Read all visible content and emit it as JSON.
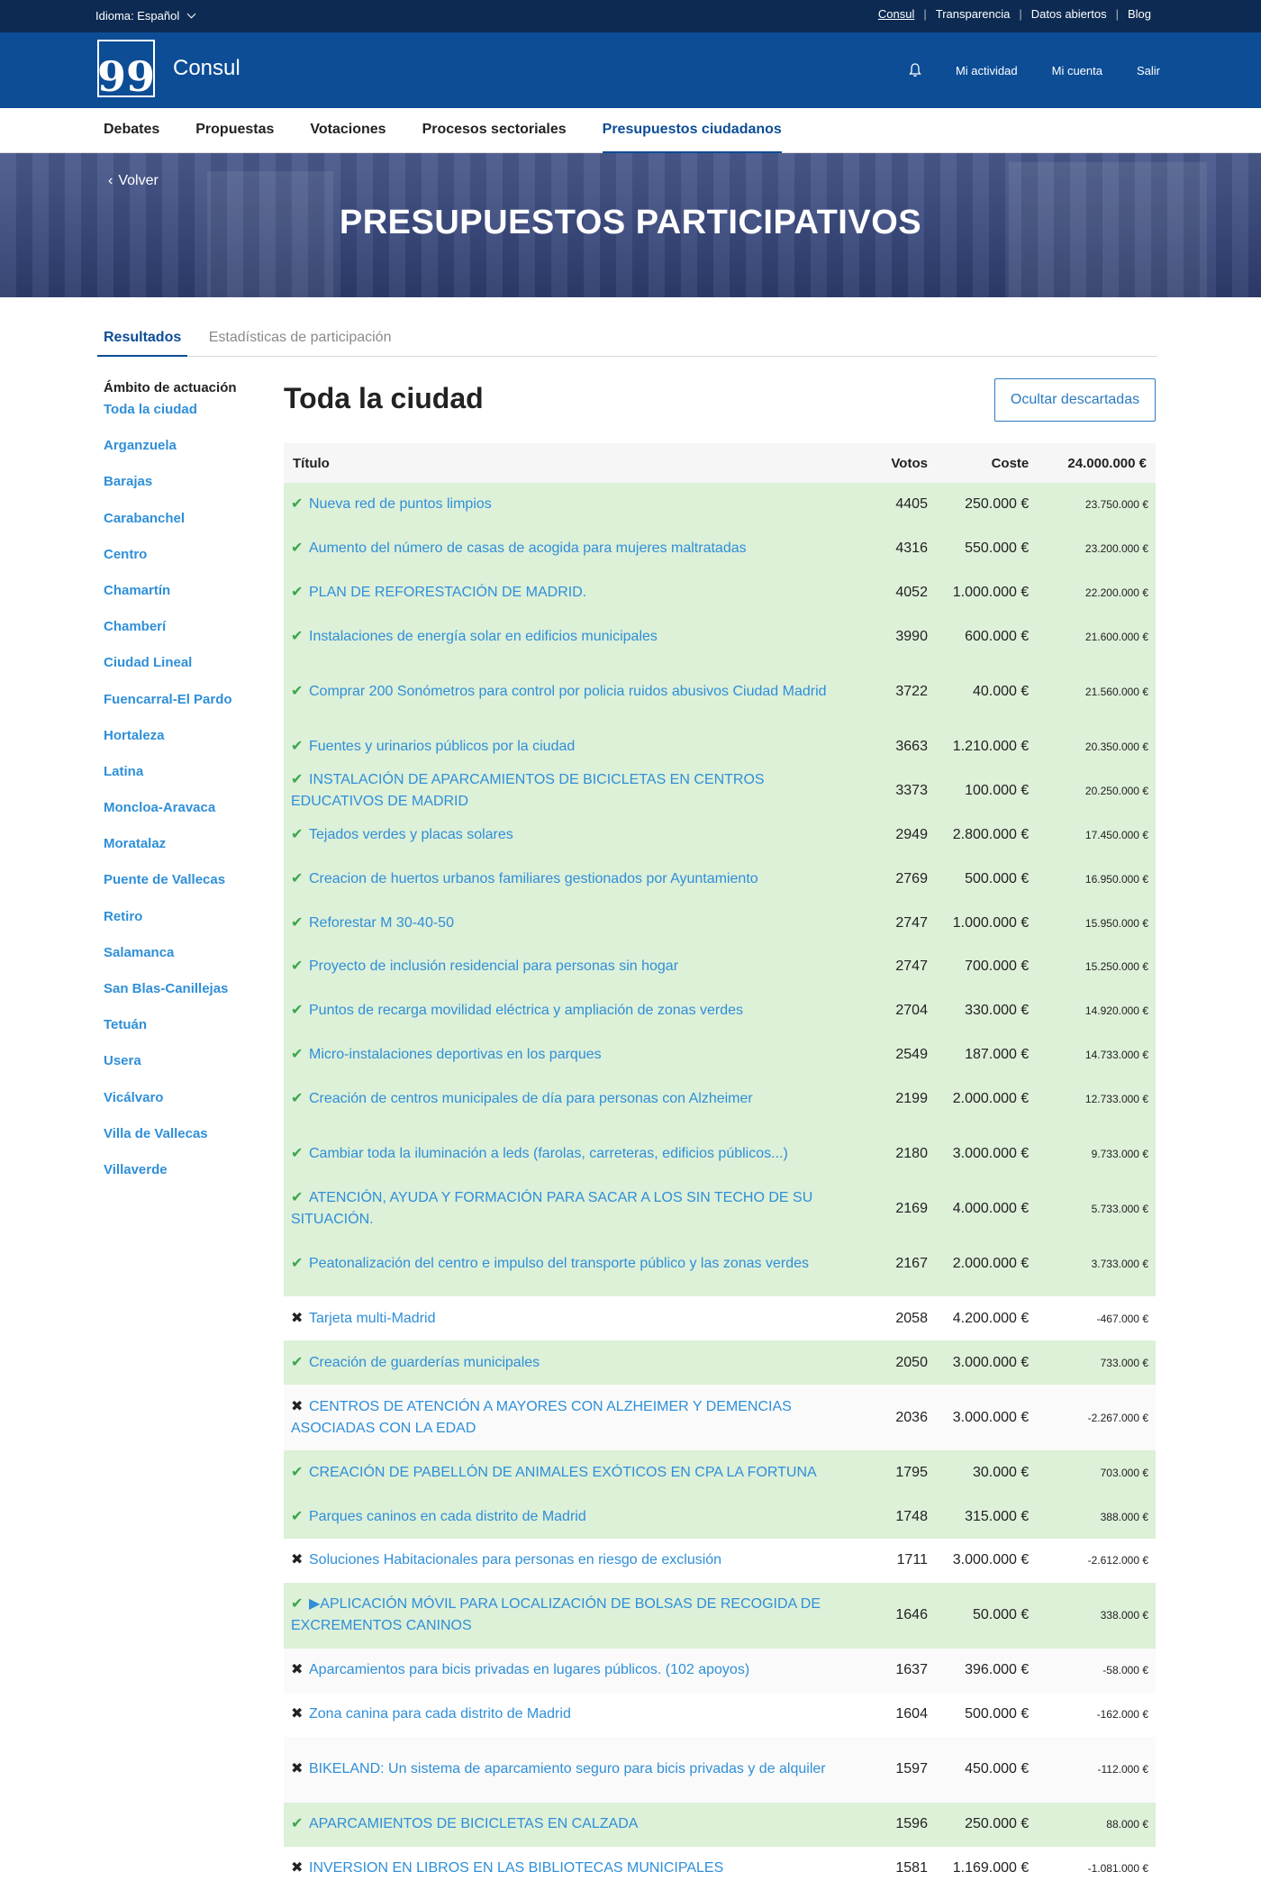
{
  "topbar": {
    "language_label": "Idioma:",
    "language_value": "Español",
    "links": [
      "Consul",
      "Transparencia",
      "Datos abiertos",
      "Blog"
    ]
  },
  "header": {
    "logo_glyph": "99",
    "app_name": "Consul",
    "user_nav": [
      "Mi actividad",
      "Mi cuenta",
      "Salir"
    ]
  },
  "main_nav": [
    "Debates",
    "Propuestas",
    "Votaciones",
    "Procesos sectoriales",
    "Presupuestos ciudadanos"
  ],
  "hero": {
    "back_label": "Volver",
    "title": "PRESUPUESTOS PARTICIPATIVOS"
  },
  "tabs": [
    "Resultados",
    "Estadísticas de participación"
  ],
  "sidebar": {
    "title": "Ámbito de actuación",
    "items": [
      "Toda la ciudad",
      "Arganzuela",
      "Barajas",
      "Carabanchel",
      "Centro",
      "Chamartín",
      "Chamberí",
      "Ciudad Lineal",
      "Fuencarral-El Pardo",
      "Hortaleza",
      "Latina",
      "Moncloa-Aravaca",
      "Moratalaz",
      "Puente de Vallecas",
      "Retiro",
      "Salamanca",
      "San Blas-Canillejas",
      "Tetuán",
      "Usera",
      "Vicálvaro",
      "Villa de Vallecas",
      "Villaverde"
    ]
  },
  "content": {
    "heading": "Toda la ciudad",
    "hide_button": "Ocultar descartadas",
    "table_headers": {
      "title": "Título",
      "votes": "Votos",
      "cost": "Coste",
      "total": "24.000.000 €"
    },
    "rows": [
      {
        "selected": true,
        "title": "Nueva red de puntos limpios",
        "votes": "4405",
        "cost": "250.000 €",
        "remaining": "23.750.000 €"
      },
      {
        "selected": true,
        "title": "Aumento del número de casas de acogida para mujeres maltratadas",
        "votes": "4316",
        "cost": "550.000 €",
        "remaining": "23.200.000 €"
      },
      {
        "selected": true,
        "title": "PLAN DE REFORESTACIÓN DE MADRID.",
        "votes": "4052",
        "cost": "1.000.000 €",
        "remaining": "22.200.000 €"
      },
      {
        "selected": true,
        "title": "Instalaciones de energía solar en edificios municipales",
        "votes": "3990",
        "cost": "600.000 €",
        "remaining": "21.600.000 €"
      },
      {
        "selected": true,
        "title": "Comprar 200 Sonómetros para control por policia ruidos abusivos Ciudad Madrid",
        "votes": "3722",
        "cost": "40.000 €",
        "remaining": "21.560.000 €"
      },
      {
        "selected": true,
        "title": "Fuentes y urinarios públicos por la ciudad",
        "votes": "3663",
        "cost": "1.210.000 €",
        "remaining": "20.350.000 €"
      },
      {
        "selected": true,
        "title": "INSTALACIÓN DE APARCAMIENTOS DE BICICLETAS EN CENTROS EDUCATIVOS DE MADRID",
        "votes": "3373",
        "cost": "100.000 €",
        "remaining": "20.250.000 €"
      },
      {
        "selected": true,
        "title": "Tejados verdes y placas solares",
        "votes": "2949",
        "cost": "2.800.000 €",
        "remaining": "17.450.000 €"
      },
      {
        "selected": true,
        "title": "Creacion de huertos urbanos familiares gestionados por Ayuntamiento",
        "votes": "2769",
        "cost": "500.000 €",
        "remaining": "16.950.000 €"
      },
      {
        "selected": true,
        "title": "Reforestar M 30-40-50",
        "votes": "2747",
        "cost": "1.000.000 €",
        "remaining": "15.950.000 €"
      },
      {
        "selected": true,
        "title": "Proyecto de inclusión residencial para personas sin hogar",
        "votes": "2747",
        "cost": "700.000 €",
        "remaining": "15.250.000 €"
      },
      {
        "selected": true,
        "title": "Puntos de recarga movilidad eléctrica y ampliación de zonas verdes",
        "votes": "2704",
        "cost": "330.000 €",
        "remaining": "14.920.000 €"
      },
      {
        "selected": true,
        "title": "Micro-instalaciones deportivas en los parques",
        "votes": "2549",
        "cost": "187.000 €",
        "remaining": "14.733.000 €"
      },
      {
        "selected": true,
        "title": "Creación de centros municipales de día para personas con Alzheimer",
        "votes": "2199",
        "cost": "2.000.000 €",
        "remaining": "12.733.000 €"
      },
      {
        "selected": true,
        "title": "Cambiar toda la iluminación a leds (farolas, carreteras, edificios públicos...)",
        "votes": "2180",
        "cost": "3.000.000 €",
        "remaining": "9.733.000 €"
      },
      {
        "selected": true,
        "title": "ATENCIÓN, AYUDA Y FORMACIÓN PARA SACAR A LOS SIN TECHO DE SU SITUACIÓN.",
        "votes": "2169",
        "cost": "4.000.000 €",
        "remaining": "5.733.000 €"
      },
      {
        "selected": true,
        "title": "Peatonalización del centro e impulso del transporte público y las zonas verdes",
        "votes": "2167",
        "cost": "2.000.000 €",
        "remaining": "3.733.000 €"
      },
      {
        "selected": false,
        "title": "Tarjeta multi-Madrid",
        "votes": "2058",
        "cost": "4.200.000 €",
        "remaining": "-467.000 €"
      },
      {
        "selected": true,
        "title": "Creación de guarderías municipales",
        "votes": "2050",
        "cost": "3.000.000 €",
        "remaining": "733.000 €"
      },
      {
        "selected": false,
        "title": "CENTROS DE ATENCIÓN A MAYORES CON ALZHEIMER Y DEMENCIAS ASOCIADAS CON LA EDAD",
        "votes": "2036",
        "cost": "3.000.000 €",
        "remaining": "-2.267.000 €"
      },
      {
        "selected": true,
        "title": "CREACIÓN DE PABELLÓN DE ANIMALES EXÓTICOS EN CPA LA FORTUNA",
        "votes": "1795",
        "cost": "30.000 €",
        "remaining": "703.000 €"
      },
      {
        "selected": true,
        "title": "Parques caninos en cada distrito de Madrid",
        "votes": "1748",
        "cost": "315.000 €",
        "remaining": "388.000 €"
      },
      {
        "selected": false,
        "title": "Soluciones Habitacionales para personas en riesgo de exclusión",
        "votes": "1711",
        "cost": "3.000.000 €",
        "remaining": "-2.612.000 €"
      },
      {
        "selected": true,
        "title": "▶APLICACIÓN MÓVIL PARA LOCALIZACIÓN DE BOLSAS DE RECOGIDA DE EXCREMENTOS CANINOS",
        "votes": "1646",
        "cost": "50.000 €",
        "remaining": "338.000 €"
      },
      {
        "selected": false,
        "title": "Aparcamientos para bicis privadas en lugares públicos. (102 apoyos)",
        "votes": "1637",
        "cost": "396.000 €",
        "remaining": "-58.000 €"
      },
      {
        "selected": false,
        "title": "Zona canina para cada distrito de Madrid",
        "votes": "1604",
        "cost": "500.000 €",
        "remaining": "-162.000 €"
      },
      {
        "selected": false,
        "title": "BIKELAND: Un sistema de aparcamiento seguro para bicis privadas y de alquiler",
        "votes": "1597",
        "cost": "450.000 €",
        "remaining": "-112.000 €"
      },
      {
        "selected": true,
        "title": "APARCAMIENTOS DE BICICLETAS EN CALZADA",
        "votes": "1596",
        "cost": "250.000 €",
        "remaining": "88.000 €"
      },
      {
        "selected": false,
        "title": "INVERSION EN LIBROS EN LAS BIBLIOTECAS MUNICIPALES",
        "votes": "1581",
        "cost": "1.169.000 €",
        "remaining": "-1.081.000 €"
      }
    ]
  },
  "icons": {
    "selected": "check-icon",
    "discarded": "cross-icon"
  },
  "colors": {
    "topbar": "#0d2b52",
    "header": "#0c4d96",
    "link": "#2f8fd8",
    "selected_row": "#ddf0d8",
    "check": "#3aa64a"
  }
}
